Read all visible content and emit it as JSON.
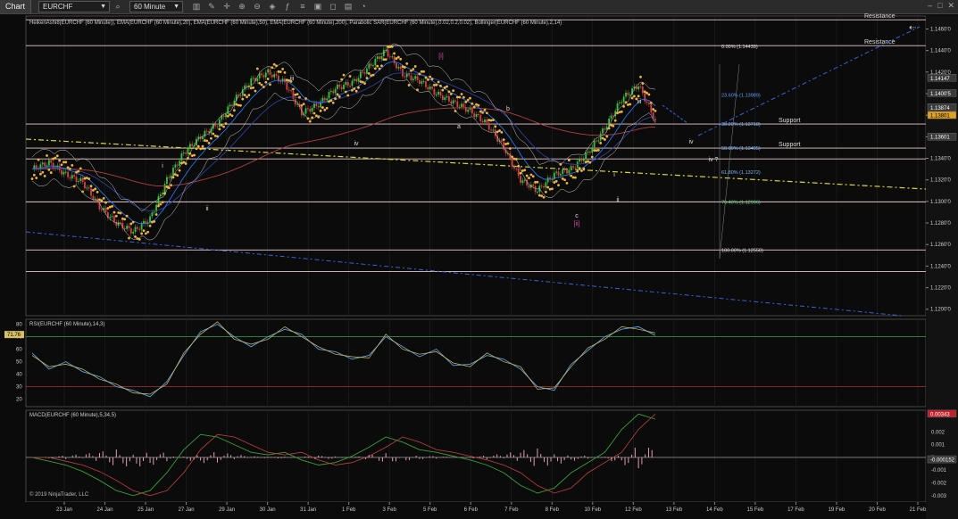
{
  "toolbar": {
    "chart_button": "Chart",
    "instrument": "EURCHF",
    "timeframe": "60 Minute"
  },
  "indicators_title": "HeikenAshi8(EURCHF (60 Minute)), EMA(EURCHF (60 Minute),20), EMA(EURCHF (60 Minute),50), EMA(EURCHF (60 Minute),200), Parabolic SAR(EURCHF (60 Minute),0.02,0.2,0.02), Bollinger(EURCHF (60 Minute),2,14)",
  "rsi_title": "RSI(EURCHF (60 Minute),14,3)",
  "macd_title": "MACD(EURCHF (60 Minute),5,34,5)",
  "copyright": "© 2019 NinjaTrader, LLC",
  "colors": {
    "background": "#0b0b0b",
    "ema20": "#2a7fff",
    "ema200": "#b04040",
    "sar": "#f0b43c",
    "bull": "#3fc03f",
    "bear": "#d04545",
    "level_line": "#e9c9c9",
    "trend_yellow": "#d8d830",
    "trend_blue": "#3a63d8"
  },
  "chart_data": [
    {
      "type": "line",
      "panel": "price",
      "x_ticks": [
        "23 Jan",
        "24 Jan",
        "25 Jan",
        "27 Jan",
        "29 Jan",
        "30 Jan",
        "31 Jan",
        "1 Feb",
        "3 Feb",
        "5 Feb",
        "6 Feb",
        "7 Feb",
        "8 Feb",
        "10 Feb",
        "12 Feb",
        "13 Feb",
        "14 Feb",
        "15 Feb",
        "17 Feb",
        "19 Feb",
        "20 Feb",
        "21 Feb"
      ],
      "y_ticks": [
        "1.1460'0",
        "1.1440'0",
        "1.1420'0",
        "1.1400'0",
        "1.1380'0",
        "1.1360'0",
        "1.1340'0",
        "1.1320'0",
        "1.1300'0",
        "1.1280'0",
        "1.1260'0",
        "1.1240'0",
        "1.1220'0",
        "1.1200'0"
      ],
      "ylim": [
        1.1194,
        1.1472
      ],
      "price_labels": [
        {
          "text": "1.14147",
          "value": 1.14147,
          "color": "#3a3a3a"
        },
        {
          "text": "1.1400'5",
          "value": 1.14005,
          "color": "#3a3a3a"
        },
        {
          "text": "1.13874",
          "value": 1.13874,
          "color": "#3a3a3a"
        },
        {
          "text": "1.13801",
          "value": 1.13801,
          "color": "#e0a020"
        },
        {
          "text": "1.13601",
          "value": 1.13601,
          "color": "#3a3a3a"
        }
      ],
      "horizontal_levels": [
        {
          "value": 1.14685,
          "label": "Resistance"
        },
        {
          "value": 1.14445,
          "label": "Resistance"
        },
        {
          "value": 1.13718,
          "label": "Support"
        },
        {
          "value": 1.13495,
          "label": "Support"
        },
        {
          "value": 1.13395,
          "label": ""
        },
        {
          "value": 1.12996,
          "label": ""
        },
        {
          "value": 1.1255,
          "label": ""
        },
        {
          "value": 1.1235,
          "label": ""
        }
      ],
      "fibonacci": [
        {
          "text": "0.00% (1.14439)",
          "value": 1.14439
        },
        {
          "text": "23.60% (1.13989)",
          "value": 1.13989
        },
        {
          "text": "38.20% (1.13718)",
          "value": 1.13718
        },
        {
          "text": "50.00% (1.13495)",
          "value": 1.13495
        },
        {
          "text": "61.80% (1.13272)",
          "value": 1.13272
        },
        {
          "text": "76.40% (1.12996)",
          "value": 1.12996
        },
        {
          "text": "100.00% (1.12550)",
          "value": 1.1255
        }
      ],
      "wave_labels": [
        "i",
        "ii",
        "iii",
        "iv",
        "a",
        "b",
        "c",
        "[ii]",
        "[i]",
        "i",
        "ii",
        "iii",
        "iv",
        "iv ?",
        "c"
      ],
      "close_series": [
        1.133,
        1.1336,
        1.1325,
        1.1318,
        1.1295,
        1.128,
        1.1272,
        1.1284,
        1.132,
        1.1345,
        1.136,
        1.1372,
        1.1394,
        1.1412,
        1.142,
        1.141,
        1.1382,
        1.139,
        1.1405,
        1.141,
        1.1425,
        1.144,
        1.1418,
        1.1412,
        1.14,
        1.1392,
        1.1384,
        1.1372,
        1.135,
        1.132,
        1.131,
        1.1325,
        1.133,
        1.1345,
        1.1368,
        1.1395,
        1.1408,
        1.1375
      ]
    },
    {
      "type": "line",
      "panel": "rsi",
      "title": "RSI(EURCHF (60 Minute),14,3)",
      "y_ticks": [
        "80",
        "70",
        "60",
        "50",
        "40",
        "30",
        "20"
      ],
      "ylim": [
        14,
        84
      ],
      "current_value": "71.76",
      "levels": [
        70,
        30
      ],
      "values": [
        57,
        44,
        50,
        42,
        38,
        30,
        27,
        22,
        34,
        55,
        74,
        80,
        70,
        62,
        70,
        76,
        72,
        60,
        58,
        52,
        55,
        70,
        62,
        54,
        60,
        47,
        48,
        55,
        52,
        44,
        30,
        27,
        48,
        59,
        70,
        76,
        78,
        71
      ]
    },
    {
      "type": "bar",
      "panel": "macd",
      "title": "MACD(EURCHF (60 Minute),5,34,5)",
      "y_ticks": [
        "0.002",
        "0.001",
        "0",
        "-0.001",
        "-0.002",
        "-0.003"
      ],
      "ylim": [
        -0.0035,
        0.0037
      ],
      "current_values": [
        {
          "text": "0.00343",
          "value": 0.00343,
          "color": "#c0202a"
        },
        {
          "text": "-0.000152",
          "value": -0.000152,
          "color": "#3a3a3a"
        }
      ],
      "macd_line": [
        0.0,
        -0.0003,
        -0.0006,
        -0.0011,
        -0.0018,
        -0.0026,
        -0.003,
        -0.0026,
        -0.0012,
        0.0006,
        0.0018,
        0.0016,
        0.001,
        0.0004,
        0.0002,
        0.0004,
        -0.0002,
        -0.0006,
        -0.0004,
        0.0001,
        0.0008,
        0.0016,
        0.0012,
        0.0006,
        0.0004,
        0.0001,
        -0.0002,
        -0.0006,
        -0.0012,
        -0.0022,
        -0.0028,
        -0.0024,
        -0.0012,
        -0.0004,
        0.0004,
        0.0022,
        0.0034,
        0.003
      ]
    }
  ]
}
